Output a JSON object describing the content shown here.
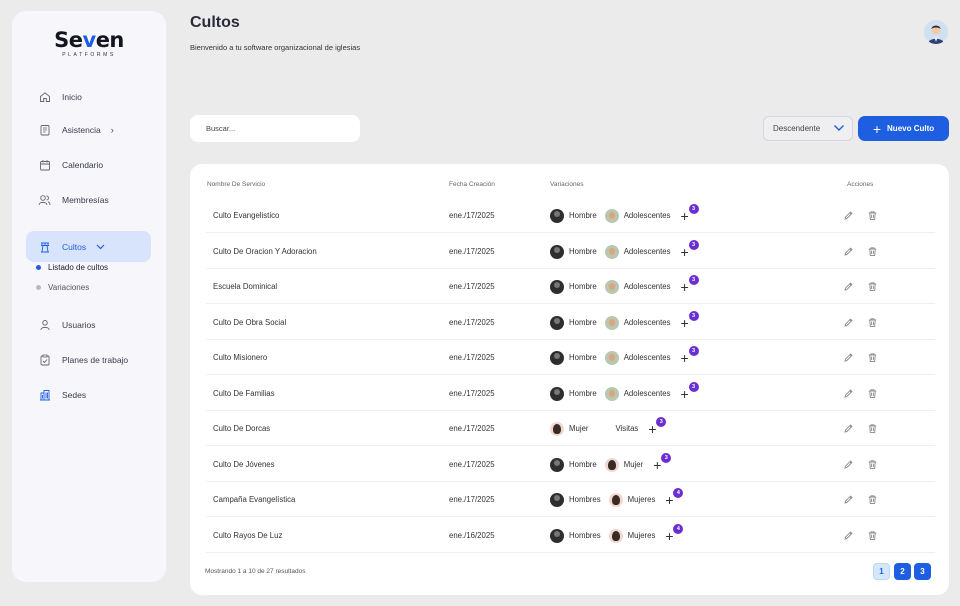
{
  "brand": {
    "name_pre": "Se",
    "name_v": "v",
    "name_post": "en",
    "tagline": "PLATFORMS"
  },
  "sidebar": {
    "items": [
      {
        "label": "Inicio",
        "icon": "home-icon"
      },
      {
        "label": "Asistencia",
        "icon": "clipboard-icon",
        "chevron": "›"
      },
      {
        "label": "Calendario",
        "icon": "calendar-icon"
      },
      {
        "label": "Membresías",
        "icon": "users-icon"
      },
      {
        "label": "Cultos",
        "icon": "church-icon",
        "chevron": "⌄",
        "active": true
      },
      {
        "label": "Usuarios",
        "icon": "user-icon"
      },
      {
        "label": "Planes de trabajo",
        "icon": "clipboard-check-icon"
      },
      {
        "label": "Sedes",
        "icon": "building-icon"
      }
    ],
    "subitems": [
      {
        "label": "Listado de cultos",
        "active": true
      },
      {
        "label": "Variaciones",
        "active": false
      }
    ]
  },
  "header": {
    "title": "Cultos",
    "subtitle": "Bienvenido a tu software organizacional de iglesias"
  },
  "toolbar": {
    "search_placeholder": "Buscar...",
    "sort_value": "Descendente",
    "new_button_plus": "+",
    "new_button_label": "Nuevo Culto"
  },
  "table": {
    "columns": [
      "Nombre De Servicio",
      "Fecha Creación",
      "Variaciones",
      "Acciones"
    ],
    "rows": [
      {
        "name": "Culto Evangelistico",
        "date": "ene./17/2025",
        "var1": "Hombre",
        "var1_av": "dark",
        "var2": "Adolescentes",
        "var2_av": "teen",
        "more": "+",
        "badge": "3"
      },
      {
        "name": "Culto De Oracion Y Adoracion",
        "date": "ene./17/2025",
        "var1": "Hombre",
        "var1_av": "dark",
        "var2": "Adolescentes",
        "var2_av": "teen",
        "more": "+",
        "badge": "3"
      },
      {
        "name": "Escuela Dominical",
        "date": "ene./17/2025",
        "var1": "Hombre",
        "var1_av": "dark",
        "var2": "Adolescentes",
        "var2_av": "teen",
        "more": "+",
        "badge": "3"
      },
      {
        "name": "Culto De Obra Social",
        "date": "ene./17/2025",
        "var1": "Hombre",
        "var1_av": "dark",
        "var2": "Adolescentes",
        "var2_av": "teen",
        "more": "+",
        "badge": "3"
      },
      {
        "name": "Culto Misionero",
        "date": "ene./17/2025",
        "var1": "Hombre",
        "var1_av": "dark",
        "var2": "Adolescentes",
        "var2_av": "teen",
        "more": "+",
        "badge": "3"
      },
      {
        "name": "Culto De Familias",
        "date": "ene./17/2025",
        "var1": "Hombre",
        "var1_av": "dark",
        "var2": "Adolescentes",
        "var2_av": "teen",
        "more": "+",
        "badge": "3"
      },
      {
        "name": "Culto De Dorcas",
        "date": "ene./17/2025",
        "var1": "Mujer",
        "var1_av": "woman",
        "var2": "Visitas",
        "var2_av": "visit",
        "more": "+",
        "badge": "3"
      },
      {
        "name": "Culto De Jóvenes",
        "date": "ene./17/2025",
        "var1": "Hombre",
        "var1_av": "dark",
        "var2": "Mujer",
        "var2_av": "woman",
        "more": "+",
        "badge": "3"
      },
      {
        "name": "Campaña Evangelística",
        "date": "ene./17/2025",
        "var1": "Hombres",
        "var1_av": "dark",
        "var2": "Mujeres",
        "var2_av": "woman",
        "more": "+",
        "badge": "4"
      },
      {
        "name": "Culto Rayos De Luz",
        "date": "ene./16/2025",
        "var1": "Hombres",
        "var1_av": "dark",
        "var2": "Mujeres",
        "var2_av": "woman",
        "more": "+",
        "badge": "4"
      }
    ]
  },
  "footer": {
    "showing": "Mostrando 1 a 10 de 27 resultados",
    "pages": [
      "1",
      "2",
      "3"
    ],
    "current_page": "1"
  },
  "colors": {
    "accent": "#1d5fe0",
    "badge": "#6b2fd1",
    "active_bg": "#d7e4fb"
  }
}
